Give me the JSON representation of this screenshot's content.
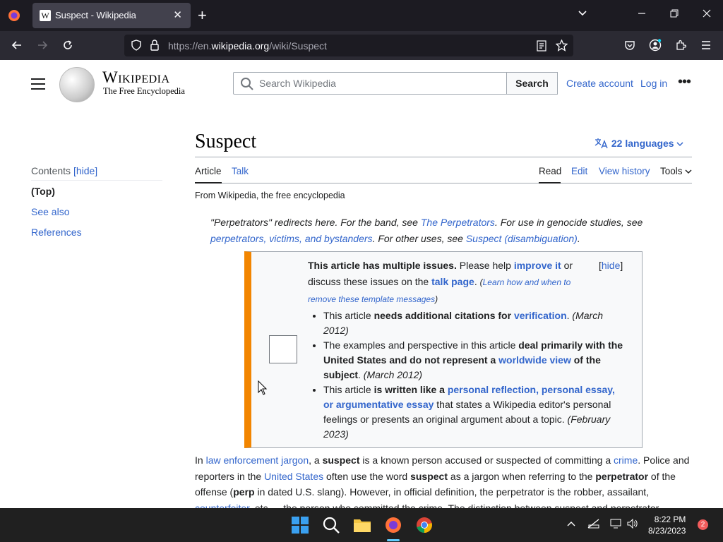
{
  "browser": {
    "tab_title": "Suspect - Wikipedia",
    "url_prefix": "https://en.",
    "url_domain": "wikipedia.org",
    "url_path": "/wiki/Suspect"
  },
  "header": {
    "wordmark": "Wikipedia",
    "tagline": "The Free Encyclopedia",
    "search_placeholder": "Search Wikipedia",
    "search_button": "Search",
    "create_account": "Create account",
    "log_in": "Log in"
  },
  "toc": {
    "title": "Contents",
    "hide": "[hide]",
    "items": [
      "(Top)",
      "See also",
      "References"
    ]
  },
  "article": {
    "title": "Suspect",
    "languages": "22 languages",
    "tab_article": "Article",
    "tab_talk": "Talk",
    "tab_read": "Read",
    "tab_edit": "Edit",
    "tab_history": "View history",
    "tab_tools": "Tools",
    "from": "From Wikipedia, the free encyclopedia",
    "hatnote": {
      "t1": "\"Perpetrators\" redirects here. For the band, see ",
      "l1": "The Perpetrators",
      "t2": ". For use in genocide studies, see ",
      "l2": "perpetrators, victims, and bystanders",
      "t3": ". For other uses, see ",
      "l3": "Suspect (disambiguation)",
      "t4": "."
    },
    "issues": {
      "title_bold": "This article has multiple issues.",
      "t1": " Please help ",
      "improve": "improve it",
      "t2": " or discuss these issues on the ",
      "talk": "talk page",
      "t3": ". ",
      "learn": "Learn how and when to remove these template messages",
      "hide": "hide",
      "i1_a": "This article ",
      "i1_b": "needs additional citations for ",
      "i1_link": "verification",
      "i1_date": "(March 2012)",
      "i2_a": "The examples and perspective in this article ",
      "i2_b": "deal primarily with the United States and do not represent a ",
      "i2_link": "worldwide view",
      "i2_c": " of the subject",
      "i2_date": "(March 2012)",
      "i3_a": "This article ",
      "i3_b": "is written like a ",
      "i3_link": "personal reflection, personal essay, or argumentative essay",
      "i3_c": " that states a Wikipedia editor's personal feelings or presents an original argument about a topic.",
      "i3_date": "(February 2023)"
    },
    "para": {
      "t1": "In ",
      "l1": "law enforcement jargon",
      "t2": ", a ",
      "b1": "suspect",
      "t3": " is a known person accused or suspected of committing a ",
      "l2": "crime",
      "t4": ". Police and reporters in the ",
      "l3": "United States",
      "t5": " often use the word ",
      "b2": "suspect",
      "t6": " as a jargon when referring to the ",
      "b3": "perpetrator",
      "t7": " of the offense (",
      "b4": "perp",
      "t8": " in dated U.S. slang). However, in official definition, the perpetrator is the robber, assailant, ",
      "l4": "counterfeiter",
      "t9": ", etc. —the person who committed the crime. The distinction between suspect and perpetrator"
    }
  },
  "taskbar": {
    "time": "8:22 PM",
    "date": "8/23/2023",
    "notifications": "2"
  }
}
